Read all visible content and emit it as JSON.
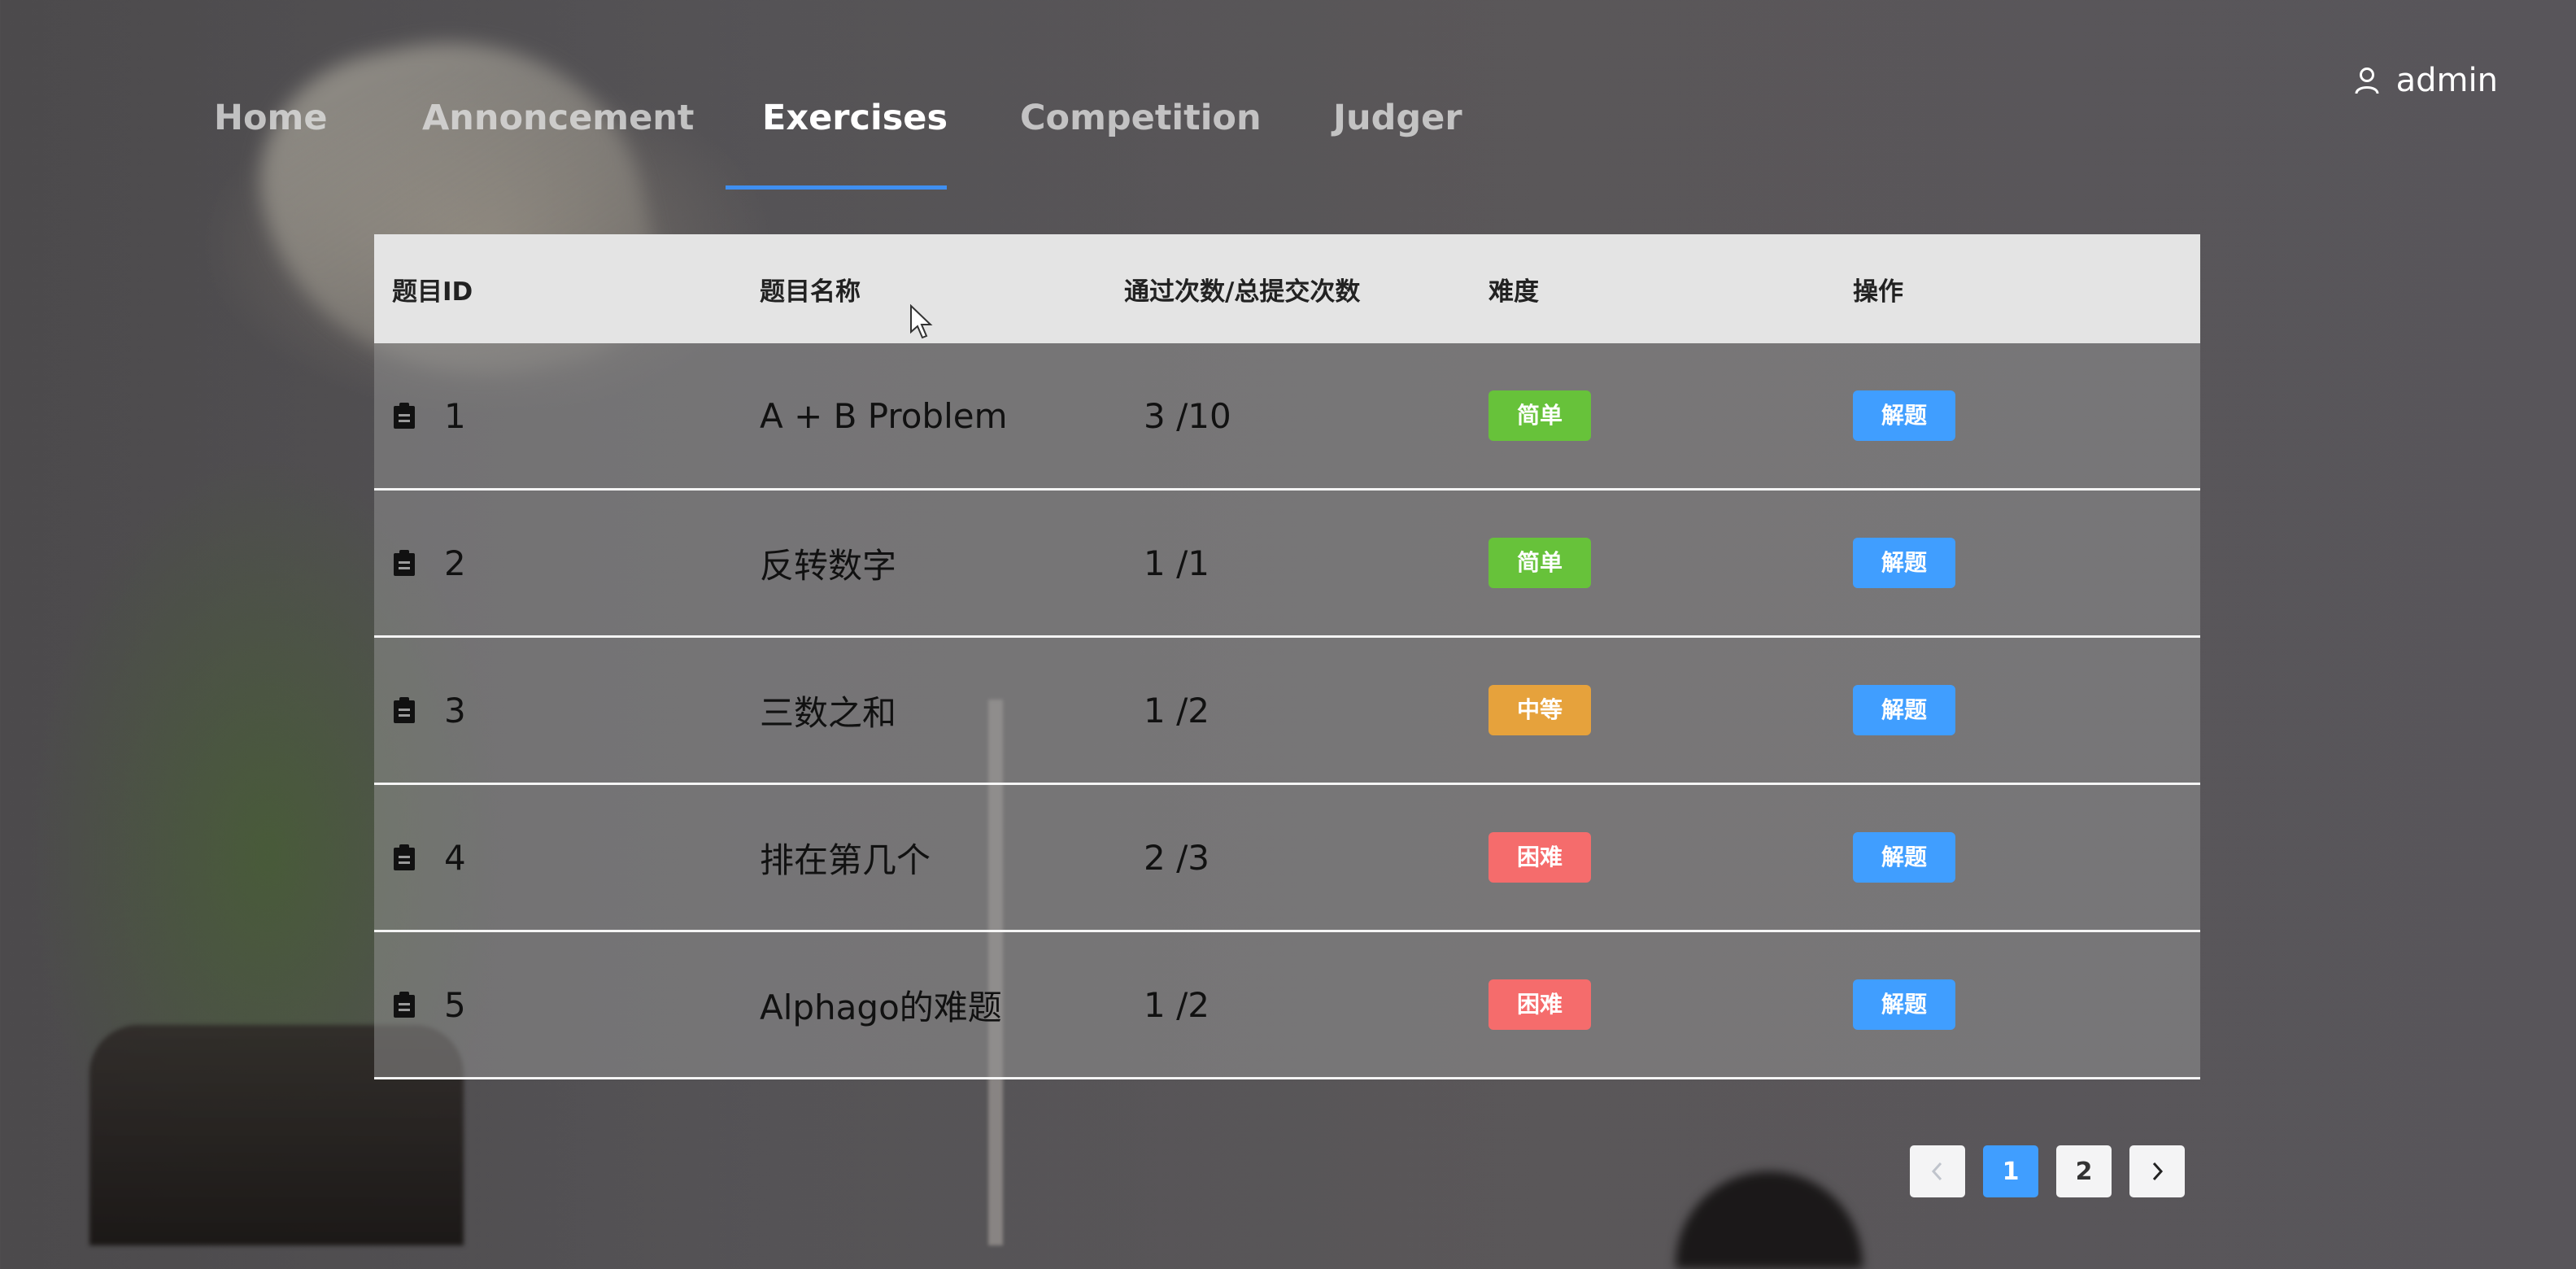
{
  "nav": {
    "items": [
      {
        "label": "Home"
      },
      {
        "label": "Annoncement"
      },
      {
        "label": "Exercises",
        "active": true
      },
      {
        "label": "Competition"
      },
      {
        "label": "Judger"
      }
    ],
    "accent_color": "#3f8ff0"
  },
  "user": {
    "name": "admin",
    "icon": "user-icon"
  },
  "table": {
    "headers": [
      "题目ID",
      "题目名称",
      "通过次数/总提交次数",
      "难度",
      "操作"
    ],
    "rows": [
      {
        "id": "1",
        "name": "A + B Problem",
        "rate": "3 /10",
        "difficulty": "简单",
        "level": "easy",
        "action": "解题"
      },
      {
        "id": "2",
        "name": "反转数字",
        "rate": "1 /1",
        "difficulty": "简单",
        "level": "easy",
        "action": "解题"
      },
      {
        "id": "3",
        "name": "三数之和",
        "rate": "1 /2",
        "difficulty": "中等",
        "level": "mid",
        "action": "解题"
      },
      {
        "id": "4",
        "name": "排在第几个",
        "rate": "2 /3",
        "difficulty": "困难",
        "level": "hard",
        "action": "解题"
      },
      {
        "id": "5",
        "name": "Alphago的难题",
        "rate": "1 /2",
        "difficulty": "困难",
        "level": "hard",
        "action": "解题"
      }
    ],
    "row_icon": "clipboard-icon",
    "difficulty_colors": {
      "easy": "#67c23a",
      "mid": "#e6a23c",
      "hard": "#f56c6c"
    },
    "action_color": "#409eff"
  },
  "pagination": {
    "prev_icon": "chevron-left-icon",
    "next_icon": "chevron-right-icon",
    "pages": [
      "1",
      "2"
    ],
    "current": "1"
  }
}
